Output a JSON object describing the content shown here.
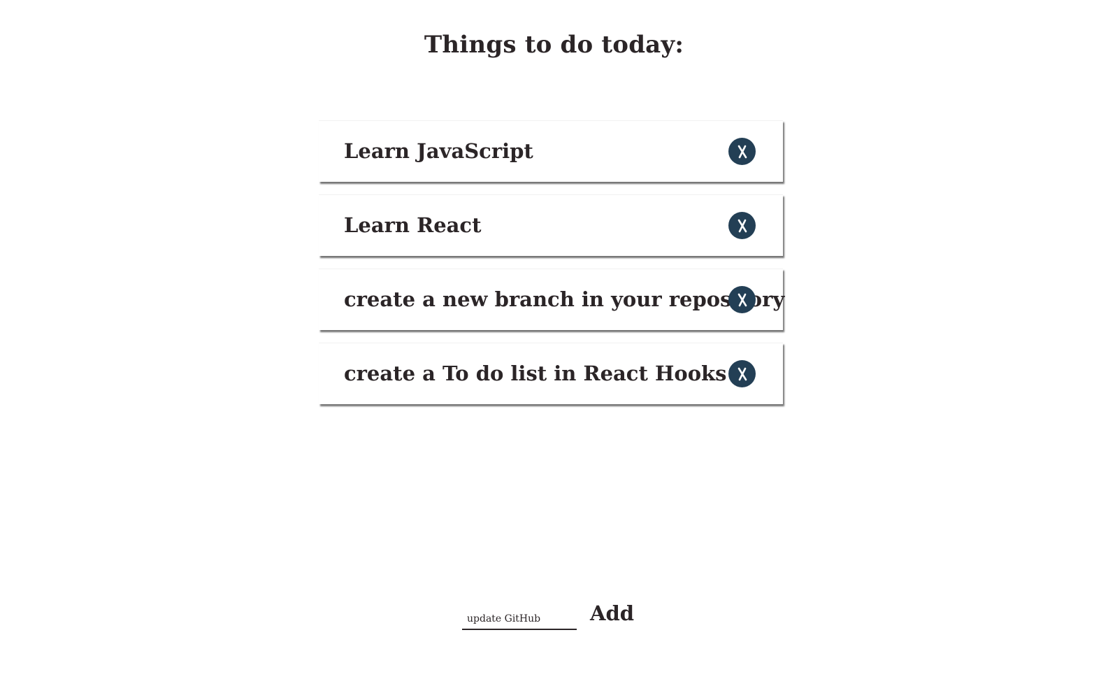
{
  "header": {
    "title": "Things to do today:"
  },
  "todos": [
    {
      "text": "Learn JavaScript"
    },
    {
      "text": "Learn React"
    },
    {
      "text": "create a new branch in your repository"
    },
    {
      "text": "create a To do list in React Hooks"
    }
  ],
  "form": {
    "input_value": "update GitHub",
    "input_placeholder": "",
    "add_label": "Add"
  },
  "colors": {
    "delete_button": "#233f55",
    "text": "#2b2527"
  },
  "icons": {
    "delete": "close-icon"
  }
}
